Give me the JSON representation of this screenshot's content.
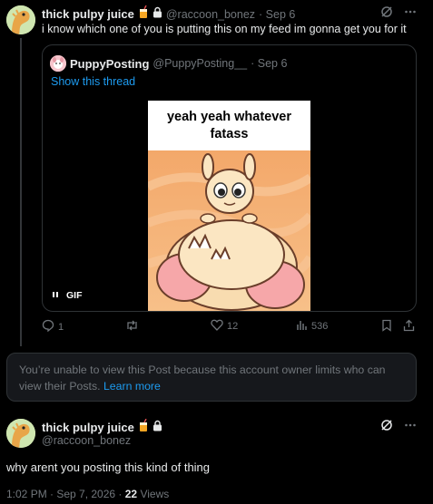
{
  "post1": {
    "display_name": "thick pulpy juice",
    "handle": "@raccoon_bonez",
    "date": "· Sep 6",
    "text": "i know which one of you is putting this on my  feed im gonna get you for it",
    "quote": {
      "display_name": "PuppyPosting",
      "handle": "@PuppyPosting__",
      "date": "· Sep 6",
      "show_thread": "Show this thread",
      "meme_caption": "yeah yeah whatever fatass",
      "gif_label": "GIF"
    },
    "actions": {
      "replies": "1",
      "reposts": "",
      "likes": "12",
      "views": "536"
    }
  },
  "notice": {
    "text": "You’re unable to view this Post because this account owner limits who can view their Posts.",
    "link": "Learn more"
  },
  "post2": {
    "display_name": "thick pulpy juice",
    "handle": "@raccoon_bonez",
    "text": "why arent you posting this kind of thing",
    "timestamp": "1:02 PM · Sep 7, 2026 ·",
    "views_count": "22",
    "views_label": "Views"
  },
  "colors": {
    "background": "#000000",
    "text": "#e7e9ea",
    "muted": "#71767b",
    "link": "#1d9bf0",
    "border": "#2f3336"
  },
  "icons": [
    "juice-emoji-icon",
    "lock-icon",
    "grok-icon",
    "more-icon",
    "reply-icon",
    "repost-icon",
    "like-icon",
    "views-icon",
    "bookmark-icon",
    "share-icon",
    "gif-pause-icon"
  ]
}
